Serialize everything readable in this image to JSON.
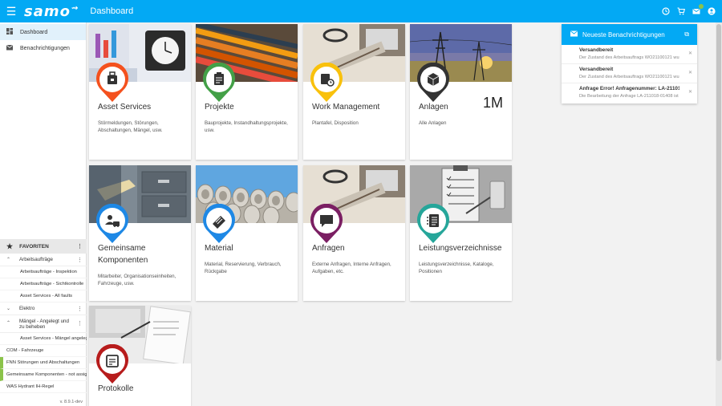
{
  "app": {
    "logo": "samo",
    "title": "Dashboard"
  },
  "topbar_icons": [
    "history-icon",
    "cart-icon",
    "mail-icon",
    "account-icon"
  ],
  "sidebar": {
    "nav": [
      {
        "label": "Dashboard",
        "icon": "dashboard-icon",
        "active": true
      },
      {
        "label": "Benachrichtigungen",
        "icon": "mail-icon",
        "active": false
      }
    ],
    "favorites_label": "FAVORITEN",
    "favorites": [
      {
        "type": "group",
        "label": "Arbeitsaufträge",
        "expanded": true
      },
      {
        "type": "sub",
        "label": "Arbeitsaufträge - Inspektion"
      },
      {
        "type": "sub",
        "label": "Arbeitsaufträge - Sichtkontrolle"
      },
      {
        "type": "sub",
        "label": "Asset Services - All faults"
      },
      {
        "type": "group",
        "label": "Elektro",
        "expanded": false
      },
      {
        "type": "group",
        "label": "Mängel - Angelegt und zu beheben",
        "expanded": true
      },
      {
        "type": "sub",
        "label": "Asset Services - Mängel angelegt"
      },
      {
        "type": "plain",
        "label": "COM - Fahrzeuge"
      },
      {
        "type": "plain",
        "label": "FNN Störungen und Abschaltungen",
        "green": true
      },
      {
        "type": "plain",
        "label": "Gemeinsame Komponenten - not assigned",
        "green": true
      },
      {
        "type": "plain",
        "label": "WAS Hydrant IH-Regel"
      }
    ],
    "version": "v. 8.9.1-dev"
  },
  "tiles": [
    {
      "title": "Asset Services",
      "desc": "Störmeldungen, Störungen, Abschaltungen, Mängel, usw.",
      "color": "#f4511e",
      "icon": "asset-services-icon",
      "count": ""
    },
    {
      "title": "Projekte",
      "desc": "Bauprojekte, Instandhaltungsprojekte, usw.",
      "color": "#43a047",
      "icon": "projects-icon",
      "count": ""
    },
    {
      "title": "Work Management",
      "desc": "Plantafel, Disposition",
      "color": "#f9c10c",
      "icon": "work-management-icon",
      "count": ""
    },
    {
      "title": "Anlagen",
      "desc": "Alle Anlagen",
      "color": "#333333",
      "icon": "box-icon",
      "count": "1M"
    },
    {
      "title": "Gemeinsame Komponenten",
      "desc": "Mitarbeiter, Organisationseinheiten, Fahrzeuge, usw.",
      "color": "#1e88e5",
      "icon": "components-icon",
      "count": ""
    },
    {
      "title": "Material",
      "desc": "Material, Reservierung, Verbrauch, Rückgabe",
      "color": "#1e88e5",
      "icon": "material-icon",
      "count": ""
    },
    {
      "title": "Anfragen",
      "desc": "Externe Anfragen, Interne Anfragen, Aufgaben, etc.",
      "color": "#7b1f63",
      "icon": "requests-icon",
      "count": ""
    },
    {
      "title": "Leistungsverzeichnisse",
      "desc": "Leistungsverzeichnisse, Kataloge, Positionen",
      "color": "#26a69a",
      "icon": "list-icon",
      "count": ""
    },
    {
      "title": "Protokolle",
      "desc": "",
      "color": "#b71c1c",
      "icon": "protocol-icon",
      "count": ""
    }
  ],
  "notifications": {
    "title": "Neueste Benachrichtigungen",
    "items": [
      {
        "title": "Versandbereit",
        "body": "Der Zustand des Arbeitsauftrags WO21100121 wurde geändert"
      },
      {
        "title": "Versandbereit",
        "body": "Der Zustand des Arbeitsauftrags WO21100121 wurde geändert"
      },
      {
        "title": "Anfrage Error! Anfragenummer: LA-211018-01408",
        "body": "Die Bearbeitung der Anfrage LA-211018-01408 ist fehlgeschlagen"
      }
    ]
  }
}
